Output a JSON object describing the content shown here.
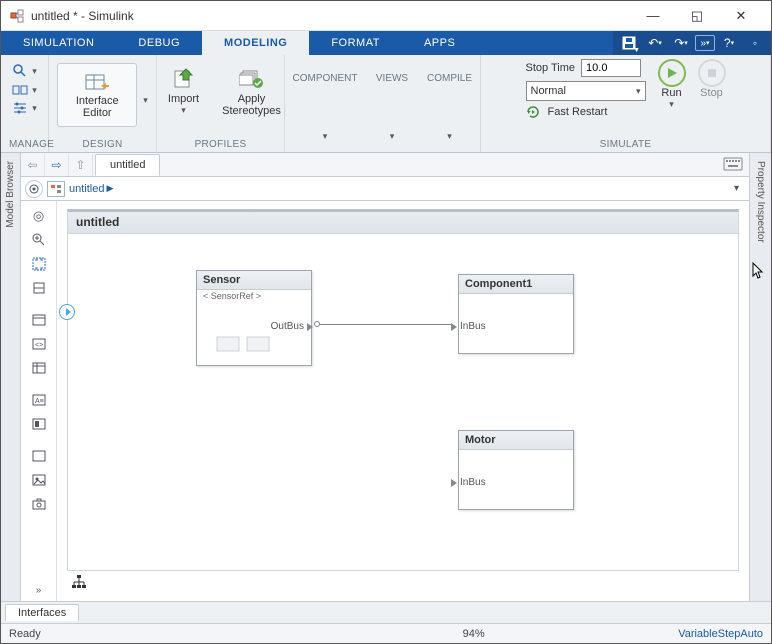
{
  "window": {
    "title": "untitled * - Simulink"
  },
  "tabs": {
    "simulation": "SIMULATION",
    "debug": "DEBUG",
    "modeling": "MODELING",
    "format": "FORMAT",
    "apps": "APPS"
  },
  "ribbon": {
    "groups": {
      "manage": "MANAGE",
      "design": "DESIGN",
      "profiles": "PROFILES",
      "simulate": "SIMULATE"
    },
    "interface_editor": "Interface\nEditor",
    "import": "Import",
    "apply_stereo": "Apply\nStereotypes",
    "component": "COMPONENT",
    "views": "VIEWS",
    "compile": "COMPILE",
    "stop_time_label": "Stop Time",
    "stop_time_value": "10.0",
    "mode": "Normal",
    "fast_restart": "Fast Restart",
    "run": "Run",
    "stop": "Stop"
  },
  "nav": {
    "tab": "untitled"
  },
  "path": {
    "crumb": "untitled"
  },
  "model_browser": "Model Browser",
  "property_inspector": "Property Inspector",
  "canvas": {
    "title": "untitled",
    "sensor": {
      "name": "Sensor",
      "ref": "< SensorRef >",
      "out_port": "OutBus"
    },
    "component1": {
      "name": "Component1",
      "in_port": "InBus"
    },
    "motor": {
      "name": "Motor",
      "in_port": "InBus"
    }
  },
  "footer": {
    "interfaces": "Interfaces"
  },
  "status": {
    "ready": "Ready",
    "zoom": "94%",
    "solver": "VariableStepAuto"
  }
}
